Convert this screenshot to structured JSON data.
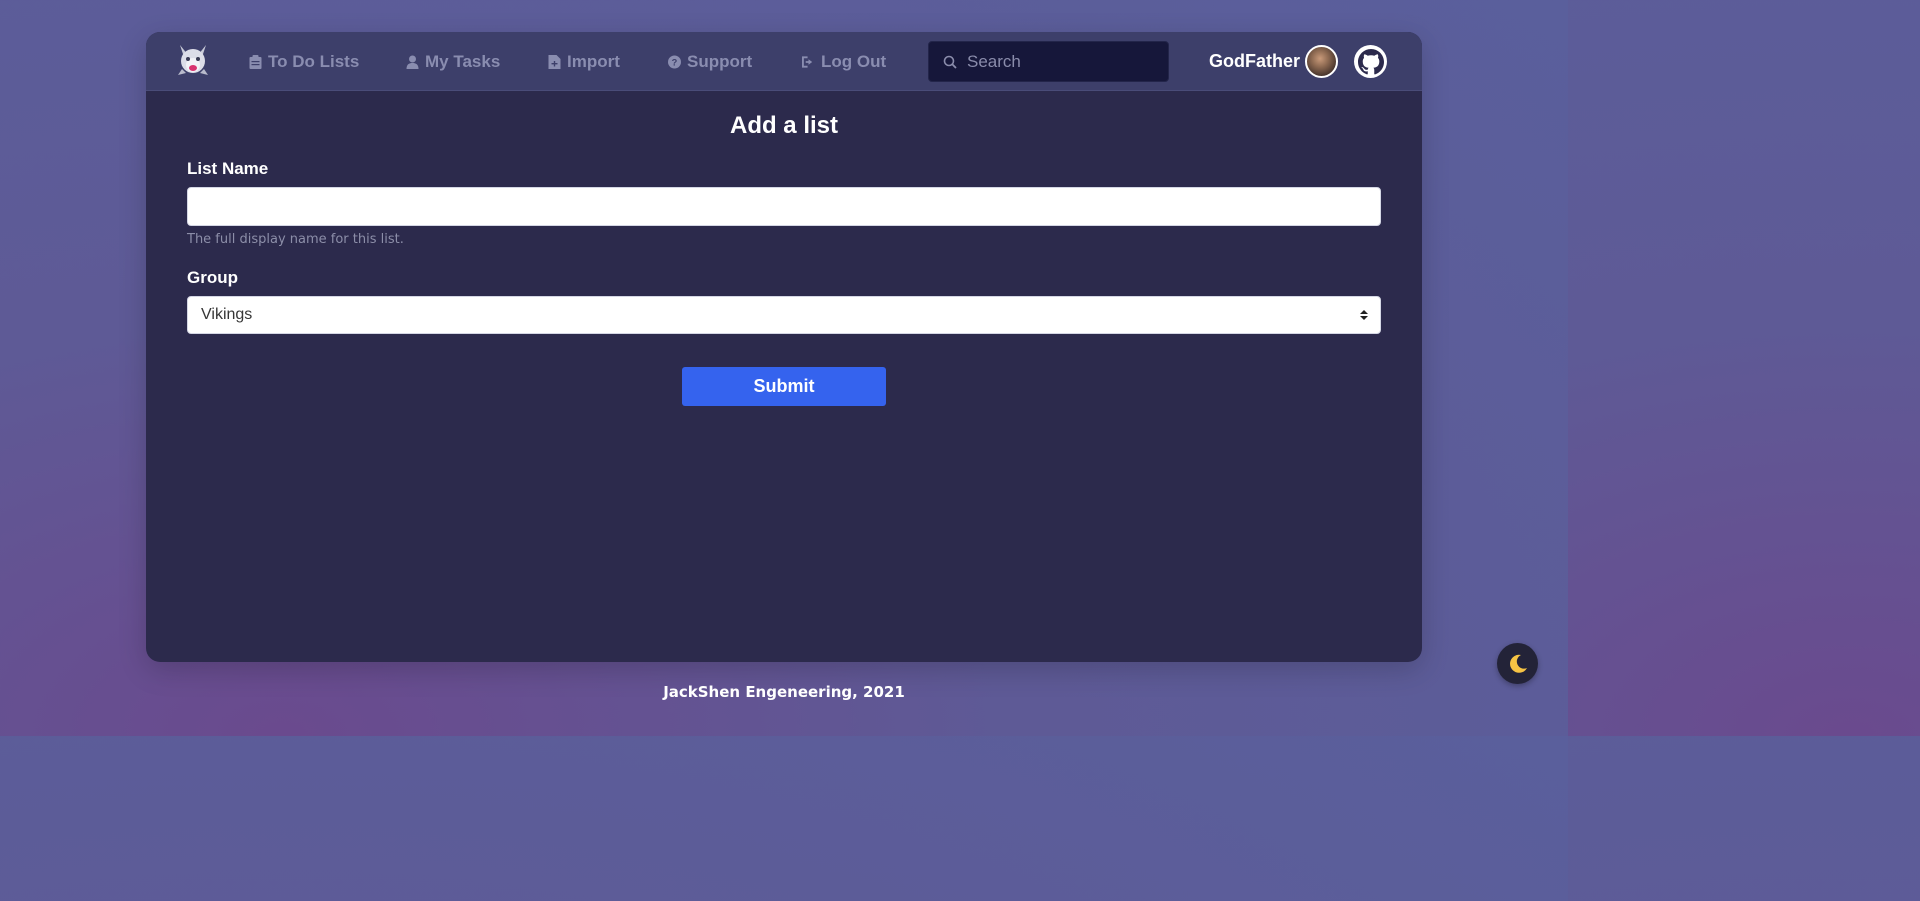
{
  "navbar": {
    "logo_icon": "wolf-logo-icon",
    "items": [
      {
        "label": "To Do Lists",
        "icon": "clipboard-icon"
      },
      {
        "label": "My Tasks",
        "icon": "user-icon"
      },
      {
        "label": "Import",
        "icon": "file-icon"
      },
      {
        "label": "Support",
        "icon": "question-circle-icon"
      },
      {
        "label": "Log Out",
        "icon": "sign-out-icon"
      }
    ],
    "search": {
      "placeholder": "Search",
      "icon": "search-icon"
    },
    "username": "GodFather",
    "github_icon": "github-icon"
  },
  "form": {
    "title": "Add a list",
    "list_name": {
      "label": "List Name",
      "value": "",
      "help": "The full display name for this list."
    },
    "group": {
      "label": "Group",
      "selected": "Vikings"
    },
    "submit_label": "Submit"
  },
  "footer": {
    "text": "JackShen Engeneering, 2021"
  },
  "theme_toggle": {
    "icon": "moon-icon"
  },
  "colors": {
    "accent": "#3563ee",
    "card_bg": "#2c2a4c",
    "navbar_bg": "#3d3f6a",
    "moon": "#f6c344"
  }
}
